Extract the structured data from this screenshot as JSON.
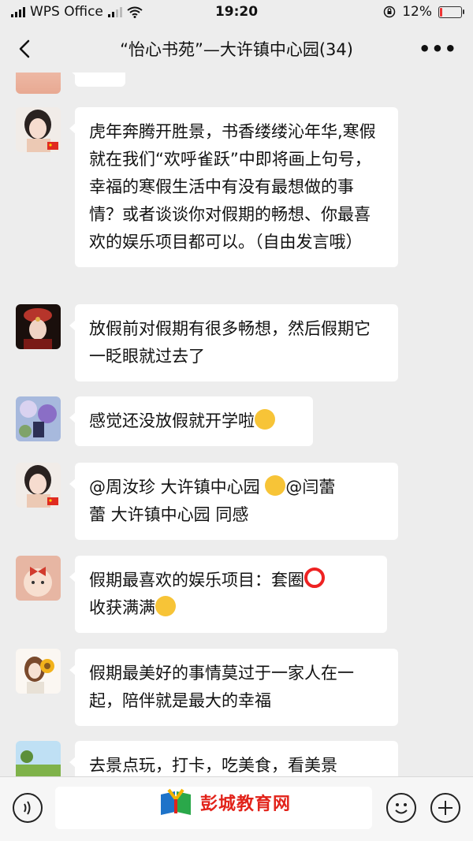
{
  "status_bar": {
    "carrier": "WPS Office",
    "time": "19:20",
    "battery": "12%",
    "battery_level": 0.12
  },
  "nav": {
    "title": "“怡心书苑”—大许镇中心园(34)",
    "back_icon": "chevron-left-icon",
    "more_icon": "more-dots-icon"
  },
  "messages": [
    {
      "avatar": "avatar-girl-portrait",
      "text": "虎年奔腾开胜景，书香缕缕沁年华,寒假就在我们“欢呼雀跃”中即将画上句号，幸福的寒假生活中有没有最想做的事情？或者谈谈你对假期的畅想、你最喜欢的娱乐项目都可以。（自由发言哦）"
    },
    {
      "avatar": "avatar-costume-portrait",
      "text": "放假前对假期有很多畅想，然后假期它一眨眼就过去了"
    },
    {
      "avatar": "avatar-flower-painting",
      "text": "感觉还没放假就开学啦"
    },
    {
      "avatar": "avatar-girl-portrait",
      "text_a": "@周汝珍  大许镇中心园 ",
      "text_b": "@闫蕾",
      "text_c": "蕾  大许镇中心园 同感"
    },
    {
      "avatar": "avatar-cartoon-bow",
      "text_a": "假期最喜欢的娱乐项目：套圈",
      "text_b": "收获满满"
    },
    {
      "avatar": "avatar-girl-sunflower",
      "text": "假期最美好的事情莫过于一家人在一起，陪伴就是最大的幸福"
    },
    {
      "avatar": "avatar-field-landscape",
      "text": "去景点玩，打卡，吃美食，看美景"
    }
  ],
  "watermark": {
    "text": "彭城教育网"
  },
  "colors": {
    "bubble": "#ffffff",
    "background": "#ededed",
    "watermark": "#e2231a"
  }
}
